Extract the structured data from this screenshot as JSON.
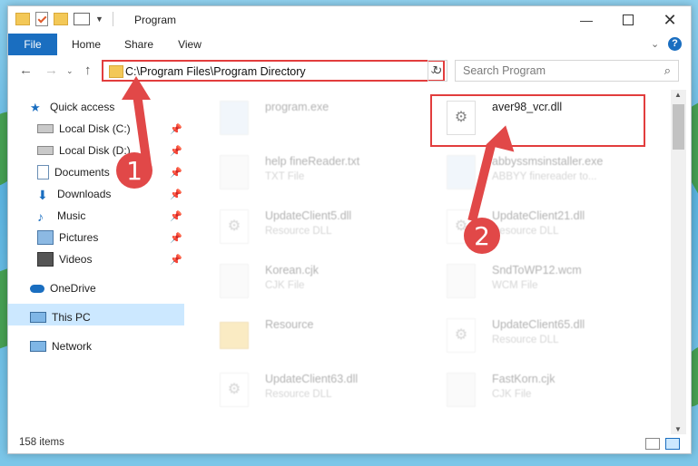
{
  "window": {
    "title": "Program"
  },
  "ribbon": {
    "tabs": [
      "File",
      "Home",
      "Share",
      "View"
    ]
  },
  "address": {
    "path": "C:\\Program Files\\Program Directory"
  },
  "search": {
    "placeholder": "Search Program"
  },
  "nav": {
    "quick_access": "Quick access",
    "items": [
      {
        "label": "Local Disk (C:)",
        "icon": "drive-icon",
        "pinned": true
      },
      {
        "label": "Local Disk (D:)",
        "icon": "drive-icon",
        "pinned": true
      },
      {
        "label": "Documents",
        "icon": "documents-icon",
        "pinned": true
      },
      {
        "label": "Downloads",
        "icon": "download-icon",
        "pinned": true
      },
      {
        "label": "Music",
        "icon": "music-icon",
        "pinned": true
      },
      {
        "label": "Pictures",
        "icon": "pictures-icon",
        "pinned": true
      },
      {
        "label": "Videos",
        "icon": "videos-icon",
        "pinned": true
      }
    ],
    "onedrive": "OneDrive",
    "thispc": "This PC",
    "network": "Network"
  },
  "files": [
    {
      "name": "program.exe",
      "type": "",
      "col": 0,
      "row": 0,
      "faded": true,
      "icon": "exe-icon"
    },
    {
      "name": "aver98_vcr.dll",
      "type": "",
      "col": 1,
      "row": 0,
      "faded": false,
      "icon": "dll-gear-icon"
    },
    {
      "name": "help fineReader.txt",
      "type": "TXT File",
      "col": 0,
      "row": 1,
      "faded": true,
      "icon": "text-icon"
    },
    {
      "name": "abbyssmsinstaller.exe",
      "type": "ABBYY finereader to...",
      "col": 1,
      "row": 1,
      "faded": true,
      "icon": "exe-icon"
    },
    {
      "name": "UpdateClient5.dll",
      "type": "Resource DLL",
      "col": 0,
      "row": 2,
      "faded": true,
      "icon": "dll-gear-icon"
    },
    {
      "name": "UpdateClient21.dll",
      "type": "Resource DLL",
      "col": 1,
      "row": 2,
      "faded": true,
      "icon": "dll-gear-icon"
    },
    {
      "name": "Korean.cjk",
      "type": "CJK File",
      "col": 0,
      "row": 3,
      "faded": true,
      "icon": "file-icon"
    },
    {
      "name": "SndToWP12.wcm",
      "type": "WCM File",
      "col": 1,
      "row": 3,
      "faded": true,
      "icon": "file-icon"
    },
    {
      "name": "Resource",
      "type": "",
      "col": 0,
      "row": 4,
      "faded": true,
      "icon": "folder-icon"
    },
    {
      "name": "UpdateClient65.dll",
      "type": "Resource DLL",
      "col": 1,
      "row": 4,
      "faded": true,
      "icon": "dll-gear-icon"
    },
    {
      "name": "UpdateClient63.dll",
      "type": "Resource DLL",
      "col": 0,
      "row": 5,
      "faded": true,
      "icon": "dll-gear-icon"
    },
    {
      "name": "FastKorn.cjk",
      "type": "CJK File",
      "col": 1,
      "row": 5,
      "faded": true,
      "icon": "file-icon"
    }
  ],
  "status": {
    "count": "158 items"
  },
  "annotations": {
    "step1": "1",
    "step2": "2",
    "color": "#e14848"
  }
}
